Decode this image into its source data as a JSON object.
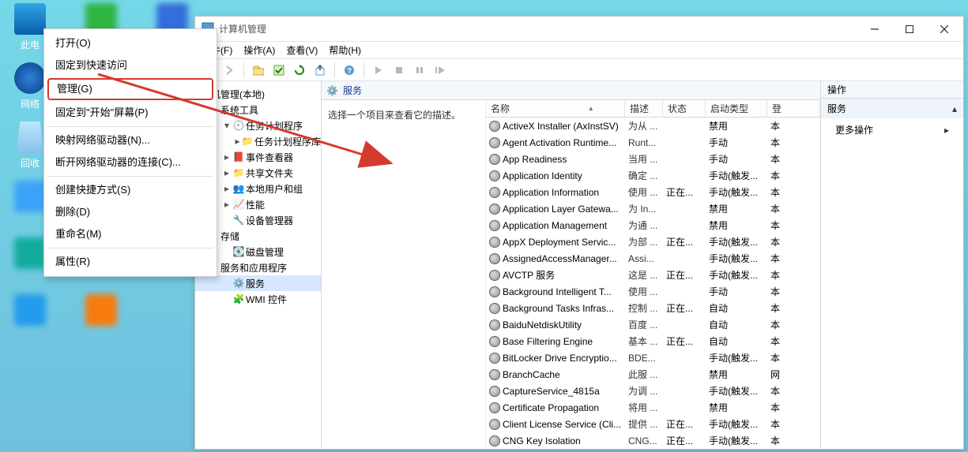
{
  "desktop": {
    "icon_this_pc": "此电",
    "icon_network": "网络",
    "icon_recycle": "回收"
  },
  "context_menu": {
    "open": "打开(O)",
    "pin_quick": "固定到快速访问",
    "manage": "管理(G)",
    "pin_start": "固定到\"开始\"屏幕(P)",
    "map_drive": "映射网络驱动器(N)...",
    "disconnect": "断开网络驱动器的连接(C)...",
    "shortcut": "创建快捷方式(S)",
    "delete": "删除(D)",
    "rename": "重命名(M)",
    "properties": "属性(R)"
  },
  "window": {
    "title": "计算机管理",
    "menu": {
      "file": "文件(F)",
      "action": "操作(A)",
      "view": "查看(V)",
      "help": "帮助(H)"
    }
  },
  "tree": {
    "root": "机管理(本地)",
    "systools": "系统工具",
    "tsched_a": "任务计划程序",
    "tsched_b": "任务计划程序库",
    "event": "事件查看器",
    "shares": "共享文件夹",
    "users": "本地用户和组",
    "perf": "性能",
    "devmgr": "设备管理器",
    "storage": "存储",
    "diskmgmt": "磁盘管理",
    "svcs_apps": "服务和应用程序",
    "services": "服务",
    "wmi": "WMI 控件"
  },
  "services_header": "服务",
  "services_hint": "选择一个项目来查看它的描述。",
  "columns": {
    "name": "名称",
    "desc": "描述",
    "state": "状态",
    "start": "启动类型",
    "logon": "登"
  },
  "actions": {
    "header": "操作",
    "sub": "服务",
    "more": "更多操作"
  },
  "rows": [
    {
      "name": "ActiveX Installer (AxInstSV)",
      "desc": "为从 ...",
      "state": "",
      "start": "禁用",
      "logon": "本"
    },
    {
      "name": "Agent Activation Runtime...",
      "desc": "Runt...",
      "state": "",
      "start": "手动",
      "logon": "本"
    },
    {
      "name": "App Readiness",
      "desc": "当用 ...",
      "state": "",
      "start": "手动",
      "logon": "本"
    },
    {
      "name": "Application Identity",
      "desc": "确定 ...",
      "state": "",
      "start": "手动(触发...",
      "logon": "本"
    },
    {
      "name": "Application Information",
      "desc": "使用 ...",
      "state": "正在...",
      "start": "手动(触发...",
      "logon": "本"
    },
    {
      "name": "Application Layer Gatewa...",
      "desc": "为 In...",
      "state": "",
      "start": "禁用",
      "logon": "本"
    },
    {
      "name": "Application Management",
      "desc": "为通 ...",
      "state": "",
      "start": "禁用",
      "logon": "本"
    },
    {
      "name": "AppX Deployment Servic...",
      "desc": "为部 ...",
      "state": "正在...",
      "start": "手动(触发...",
      "logon": "本"
    },
    {
      "name": "AssignedAccessManager...",
      "desc": "Assi...",
      "state": "",
      "start": "手动(触发...",
      "logon": "本"
    },
    {
      "name": "AVCTP 服务",
      "desc": "这是 ...",
      "state": "正在...",
      "start": "手动(触发...",
      "logon": "本"
    },
    {
      "name": "Background Intelligent T...",
      "desc": "使用 ...",
      "state": "",
      "start": "手动",
      "logon": "本"
    },
    {
      "name": "Background Tasks Infras...",
      "desc": "控制 ...",
      "state": "正在...",
      "start": "自动",
      "logon": "本"
    },
    {
      "name": "BaiduNetdiskUtility",
      "desc": "百度 ...",
      "state": "",
      "start": "自动",
      "logon": "本"
    },
    {
      "name": "Base Filtering Engine",
      "desc": "基本 ...",
      "state": "正在...",
      "start": "自动",
      "logon": "本"
    },
    {
      "name": "BitLocker Drive Encryptio...",
      "desc": "BDE...",
      "state": "",
      "start": "手动(触发...",
      "logon": "本"
    },
    {
      "name": "BranchCache",
      "desc": "此服 ...",
      "state": "",
      "start": "禁用",
      "logon": "网"
    },
    {
      "name": "CaptureService_4815a",
      "desc": "为调 ...",
      "state": "",
      "start": "手动(触发...",
      "logon": "本"
    },
    {
      "name": "Certificate Propagation",
      "desc": "将用 ...",
      "state": "",
      "start": "禁用",
      "logon": "本"
    },
    {
      "name": "Client License Service (Cli...",
      "desc": "提供 ...",
      "state": "正在...",
      "start": "手动(触发...",
      "logon": "本"
    },
    {
      "name": "CNG Key Isolation",
      "desc": "CNG...",
      "state": "正在...",
      "start": "手动(触发...",
      "logon": "本"
    }
  ]
}
